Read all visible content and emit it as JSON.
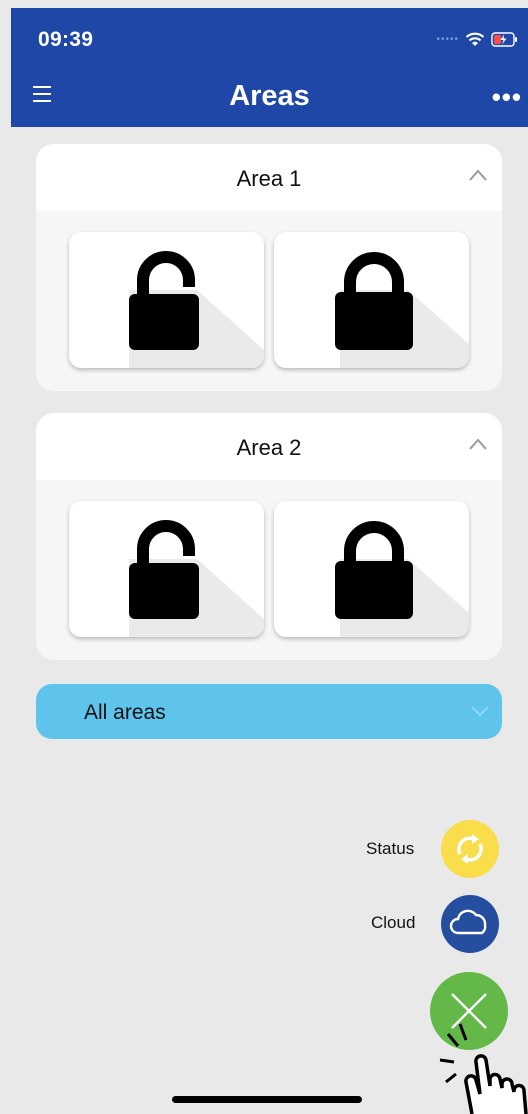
{
  "status_bar": {
    "time": "09:39"
  },
  "navbar": {
    "title": "Areas",
    "more_label": "•••"
  },
  "areas": [
    {
      "title": "Area 1",
      "locks": [
        {
          "state": "unlocked"
        },
        {
          "state": "locked"
        }
      ]
    },
    {
      "title": "Area 2",
      "locks": [
        {
          "state": "unlocked"
        },
        {
          "state": "locked"
        }
      ]
    }
  ],
  "all_areas": {
    "label": "All areas"
  },
  "fab_menu": {
    "status_label": "Status",
    "cloud_label": "Cloud"
  },
  "colors": {
    "header": "#1f47a8",
    "all_areas_bg": "#5ec4ec",
    "status_fab": "#f9dd4a",
    "cloud_fab": "#254e9e",
    "close_fab": "#63b848"
  },
  "icons": [
    "menu-icon",
    "more-icon",
    "chevron-up-icon",
    "padlock-unlocked-icon",
    "padlock-locked-icon",
    "chevron-down-icon",
    "refresh-icon",
    "cloud-icon",
    "close-icon",
    "tap-hand-icon"
  ]
}
